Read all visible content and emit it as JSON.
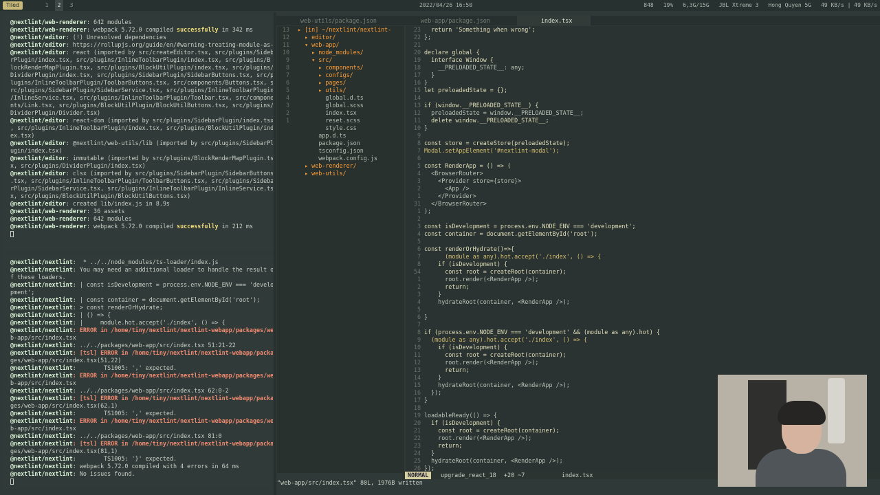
{
  "topbar": {
    "mode": "Tiled",
    "workspaces": [
      "1",
      "2",
      "3"
    ],
    "datetime": "2022/04/26 16:50",
    "status": [
      "848",
      "19%",
      "6,3G/15G",
      "JBL Xtreme 3",
      "Hong Quyen 5G",
      "49 KB/s | 49 KB/s"
    ]
  },
  "terminal_top": {
    "lines": [
      [
        "@nextlint/web-renderer",
        ": 642 modules",
        ""
      ],
      [
        "@nextlint/web-renderer",
        ": webpack 5.72.0 compiled ",
        "successfully",
        " in 342 ms"
      ],
      [
        "@nextlint/editor",
        ": (!) Unresolved dependencies",
        ""
      ],
      [
        "@nextlint/editor",
        ": https://rollupjs.org/guide/en/#warning-treating-module-as-external-dependency",
        ""
      ],
      [
        "@nextlint/editor",
        ": react (imported by src/createEditor.tsx, src/plugins/Sideba",
        ""
      ],
      [
        "",
        "rPlugin/index.tsx, src/plugins/InlineToolbarPlugin/index.tsx, src/plugins/B",
        ""
      ],
      [
        "",
        "lockRenderMapPlugin.tsx, src/plugins/BlockUtilPlugin/index.tsx, src/plugins/",
        ""
      ],
      [
        "",
        "DividerPlugin/index.tsx, src/plugins/SidebarPlugin/SidebarButtons.tsx, src/p",
        ""
      ],
      [
        "",
        "lugins/InlineToolbarPlugin/ToolbarButtons.tsx, src/components/Buttons.tsx, s",
        ""
      ],
      [
        "",
        "rc/plugins/SidebarPlugin/SidebarService.tsx, src/plugins/InlineToolbarPlugin",
        ""
      ],
      [
        "",
        "/InlineService.tsx, src/plugins/InlineToolbarPlugin/Toolbar.tsx, src/compone",
        ""
      ],
      [
        "",
        "nts/Link.tsx, src/plugins/BlockUtilPlugin/BlockUtilButtons.tsx, src/plugins/",
        ""
      ],
      [
        "",
        "DividerPlugin/Divider.tsx)",
        ""
      ],
      [
        "@nextlint/editor",
        ": react-dom (imported by src/plugins/SidebarPlugin/index.tsx",
        ""
      ],
      [
        "",
        ", src/plugins/InlineToolbarPlugin/index.tsx, src/plugins/BlockUtilPlugin/ind",
        ""
      ],
      [
        "",
        "ex.tsx)",
        ""
      ],
      [
        "@nextlint/editor",
        ": @nextlint/web-utils/lib (imported by src/plugins/SidebarPl",
        ""
      ],
      [
        "",
        "ugin/index.tsx)",
        ""
      ],
      [
        "@nextlint/editor",
        ": immutable (imported by src/plugins/BlockRenderMapPlugin.ts",
        ""
      ],
      [
        "",
        "x, src/plugins/DividerPlugin/index.tsx)",
        ""
      ],
      [
        "@nextlint/editor",
        ": clsx (imported by src/plugins/SidebarPlugin/SidebarButtons",
        ""
      ],
      [
        "",
        ".tsx, src/plugins/InlineToolbarPlugin/ToolbarButtons.tsx, src/plugins/Sideba",
        ""
      ],
      [
        "",
        "rPlugin/SidebarService.tsx, src/plugins/InlineToolbarPlugin/InlineService.ts",
        ""
      ],
      [
        "",
        "x, src/plugins/BlockUtilPlugin/BlockUtilButtons.tsx)",
        ""
      ],
      [
        "@nextlint/editor",
        ": created lib/index.js in 8.9s",
        ""
      ],
      [
        "@nextlint/web-renderer",
        ": 36 assets",
        ""
      ],
      [
        "@nextlint/web-renderer",
        ": 642 modules",
        ""
      ],
      [
        "@nextlint/web-renderer",
        ": webpack 5.72.0 compiled ",
        "successfully",
        " in 212 ms"
      ]
    ]
  },
  "terminal_bottom": {
    "lines": [
      [
        "@nextlint/nextlint",
        ":  * ../../node_modules/ts-loader/index.js",
        ""
      ],
      [
        "@nextlint/nextlint",
        ": You may need an additional loader to handle the result o",
        ""
      ],
      [
        "",
        "f these loaders.",
        ""
      ],
      [
        "@nextlint/nextlint",
        ": | const isDevelopment = process.env.NODE_ENV === 'develo",
        ""
      ],
      [
        "",
        "pment';",
        ""
      ],
      [
        "@nextlint/nextlint",
        ": | const container = document.getElementById('root');",
        ""
      ],
      [
        "@nextlint/nextlint",
        ": > const renderOrHydrate;",
        ""
      ],
      [
        "@nextlint/nextlint",
        ": | () => {",
        ""
      ],
      [
        "@nextlint/nextlint",
        ": |     module.hot.accept('./index', () => {",
        ""
      ],
      [
        "@nextlint/nextlint",
        ": ERROR in /home/tiny/nextlint/nextlint-webapp/packages/we",
        ""
      ],
      [
        "",
        "b-app/src/index.tsx",
        ""
      ],
      [
        "@nextlint/nextlint",
        ": ../../packages/web-app/src/index.tsx 51:21-22",
        ""
      ],
      [
        "@nextlint/nextlint",
        ": [tsl] ERROR in /home/tiny/nextlint/nextlint-webapp/packa",
        ""
      ],
      [
        "",
        "ges/web-app/src/index.tsx(51,22)",
        ""
      ],
      [
        "@nextlint/nextlint",
        ":        TS1005: ',' expected.",
        ""
      ],
      [
        "@nextlint/nextlint",
        ": ERROR in /home/tiny/nextlint/nextlint-webapp/packages/we",
        ""
      ],
      [
        "",
        "b-app/src/index.tsx",
        ""
      ],
      [
        "@nextlint/nextlint",
        ": ../../packages/web-app/src/index.tsx 62:0-2",
        ""
      ],
      [
        "@nextlint/nextlint",
        ": [tsl] ERROR in /home/tiny/nextlint/nextlint-webapp/packa",
        ""
      ],
      [
        "",
        "ges/web-app/src/index.tsx(62,1)",
        ""
      ],
      [
        "@nextlint/nextlint",
        ":        TS1005: ',' expected.",
        ""
      ],
      [
        "@nextlint/nextlint",
        ": ERROR in /home/tiny/nextlint/nextlint-webapp/packages/we",
        ""
      ],
      [
        "",
        "b-app/src/index.tsx",
        ""
      ],
      [
        "@nextlint/nextlint",
        ": ../../packages/web-app/src/index.tsx 81:0",
        ""
      ],
      [
        "@nextlint/nextlint",
        ": [tsl] ERROR in /home/tiny/nextlint/nextlint-webapp/packa",
        ""
      ],
      [
        "",
        "ges/web-app/src/index.tsx(81,1)",
        ""
      ],
      [
        "@nextlint/nextlint",
        ":        TS1005: '}' expected.",
        ""
      ],
      [
        "@nextlint/nextlint",
        ": webpack 5.72.0 compiled with 4 errors in 64 ms",
        ""
      ],
      [
        "@nextlint/nextlint",
        ": No issues found.",
        ""
      ]
    ]
  },
  "tabs": [
    {
      "label": "web-utils/package.json"
    },
    {
      "label": "web-app/package.json"
    },
    {
      "label": "index.tsx",
      "active": true
    }
  ],
  "tree": [
    [
      "13",
      "▸ [in] ~/nextlint/nextlint-"
    ],
    [
      "12",
      "  ▸ editor/"
    ],
    [
      "11",
      "  ▾ web-app/"
    ],
    [
      "10",
      "    ▸ node_modules/"
    ],
    [
      "9",
      "    ▾ src/"
    ],
    [
      "8",
      "      ▸ components/"
    ],
    [
      "7",
      "      ▸ configs/"
    ],
    [
      "6",
      "      ▸ pages/"
    ],
    [
      "5",
      "      ▸ utils/"
    ],
    [
      "4",
      "        global.d.ts"
    ],
    [
      "3",
      "        global.scss"
    ],
    [
      "2",
      "        index.tsx"
    ],
    [
      "1",
      "        reset.scss"
    ],
    [
      "",
      "        style.css"
    ],
    [
      "",
      "      app.d.ts"
    ],
    [
      "",
      "      package.json"
    ],
    [
      "",
      "      tsconfig.json"
    ],
    [
      "",
      "      webpack.config.js"
    ],
    [
      "",
      "  ▸ web-renderer/"
    ],
    [
      "",
      "  ▸ web-utils/"
    ]
  ],
  "code": [
    [
      "23",
      "  return 'Something when wrong';"
    ],
    [
      "22",
      "};"
    ],
    [
      "21",
      ""
    ],
    [
      "20",
      "declare global {"
    ],
    [
      "19",
      "  interface Window {"
    ],
    [
      "18",
      "    __PRELOADED_STATE__: any;"
    ],
    [
      "17",
      "  }"
    ],
    [
      "16",
      "}"
    ],
    [
      "15",
      "let preloadedState = {};"
    ],
    [
      "14",
      ""
    ],
    [
      "13",
      "if (window.__PRELOADED_STATE__) {"
    ],
    [
      "12",
      "  preloadedState = window.__PRELOADED_STATE__;"
    ],
    [
      "11",
      "  delete window.__PRELOADED_STATE__;"
    ],
    [
      "10",
      "}"
    ],
    [
      "9",
      ""
    ],
    [
      "8",
      "const store = createStore(preloadedState);"
    ],
    [
      "7",
      "Modal.setAppElement('#nextlint-modal');"
    ],
    [
      "6",
      ""
    ],
    [
      "5",
      "const RenderApp = () => ("
    ],
    [
      "4",
      "  <BrowserRouter>"
    ],
    [
      "3",
      "    <Provider store={store}>"
    ],
    [
      "2",
      "      <App />"
    ],
    [
      "1",
      "    </Provider>"
    ],
    [
      "31",
      "  </BrowserRouter>"
    ],
    [
      "1",
      ");"
    ],
    [
      "2",
      ""
    ],
    [
      "3",
      "const isDevelopment = process.env.NODE_ENV === 'development';"
    ],
    [
      "4",
      "const container = document.getElementById('root');"
    ],
    [
      "5",
      ""
    ],
    [
      "6",
      "const renderOrHydrate()=>{"
    ],
    [
      "7",
      "      (module as any).hot.accept('./index', () => {"
    ],
    [
      "8",
      "    if (isDevelopment) {"
    ],
    [
      "54",
      "      const root = createRoot(container);"
    ],
    [
      "1",
      "      root.render(<RenderApp />);"
    ],
    [
      "2",
      "      return;"
    ],
    [
      "3",
      "    }"
    ],
    [
      "4",
      "    hydrateRoot(container, <RenderApp />);"
    ],
    [
      "5",
      ""
    ],
    [
      "6",
      "}"
    ],
    [
      "7",
      ""
    ],
    [
      "8",
      "if (process.env.NODE_ENV === 'development' && (module as any).hot) {"
    ],
    [
      "9",
      "  (module as any).hot.accept('./index', () => {"
    ],
    [
      "10",
      "    if (isDevelopment) {"
    ],
    [
      "11",
      "      const root = createRoot(container);"
    ],
    [
      "12",
      "      root.render(<RenderApp />);"
    ],
    [
      "13",
      "      return;"
    ],
    [
      "14",
      "    }"
    ],
    [
      "15",
      "    hydrateRoot(container, <RenderApp />);"
    ],
    [
      "16",
      "  });"
    ],
    [
      "17",
      "}"
    ],
    [
      "18",
      ""
    ],
    [
      "19",
      "loadableReady(() => {"
    ],
    [
      "20",
      "  if (isDevelopment) {"
    ],
    [
      "21",
      "    const root = createRoot(container);"
    ],
    [
      "22",
      "    root.render(<RenderApp />);"
    ],
    [
      "23",
      "    return;"
    ],
    [
      "24",
      "  }"
    ],
    [
      "25",
      "  hydrateRoot(container, <RenderApp />);"
    ],
    [
      "26",
      "});"
    ]
  ],
  "statusline": {
    "mode": "NORMAL",
    "branch": "upgrade_react_18",
    "diff": "+20 ~7",
    "file": "index.tsx"
  },
  "message": "\"web-app/src/index.tsx\" 80L, 1976B written"
}
